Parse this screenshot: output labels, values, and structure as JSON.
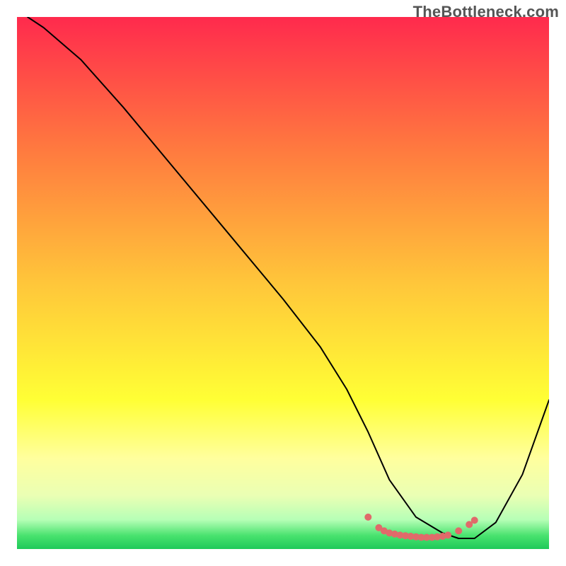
{
  "watermark": "TheBottleneck.com",
  "chart_data": {
    "type": "line",
    "title": "",
    "xlabel": "",
    "ylabel": "",
    "xlim": [
      0,
      100
    ],
    "ylim": [
      0,
      100
    ],
    "grid": false,
    "legend": false,
    "background_gradient": {
      "stops": [
        {
          "offset": 0.0,
          "color": "#ff2a4d"
        },
        {
          "offset": 0.25,
          "color": "#ff7a3f"
        },
        {
          "offset": 0.5,
          "color": "#ffc63a"
        },
        {
          "offset": 0.72,
          "color": "#ffff35"
        },
        {
          "offset": 0.83,
          "color": "#ffff9e"
        },
        {
          "offset": 0.9,
          "color": "#eaffb4"
        },
        {
          "offset": 0.945,
          "color": "#b6ffb6"
        },
        {
          "offset": 0.975,
          "color": "#48e26e"
        },
        {
          "offset": 1.0,
          "color": "#1fc95a"
        }
      ]
    },
    "series": [
      {
        "name": "bottleneck-curve",
        "color": "#000000",
        "stroke_width": 2,
        "x": [
          2,
          5,
          12,
          20,
          30,
          40,
          50,
          57,
          62,
          66,
          70,
          75,
          80,
          83,
          86,
          90,
          95,
          100
        ],
        "y": [
          100,
          98,
          92,
          83,
          71,
          59,
          47,
          38,
          30,
          22,
          13,
          6,
          3,
          2,
          2,
          5,
          14,
          28
        ]
      },
      {
        "name": "optimal-zone-markers",
        "color": "#e06a6a",
        "marker_size": 5,
        "x": [
          66,
          68,
          69,
          70,
          71,
          72,
          73,
          74,
          75,
          76,
          77,
          78,
          79,
          80,
          81,
          83,
          85,
          86
        ],
        "y": [
          6,
          4,
          3.4,
          3,
          2.8,
          2.6,
          2.5,
          2.4,
          2.3,
          2.2,
          2.2,
          2.2,
          2.3,
          2.4,
          2.6,
          3.4,
          4.6,
          5.4
        ]
      }
    ]
  }
}
